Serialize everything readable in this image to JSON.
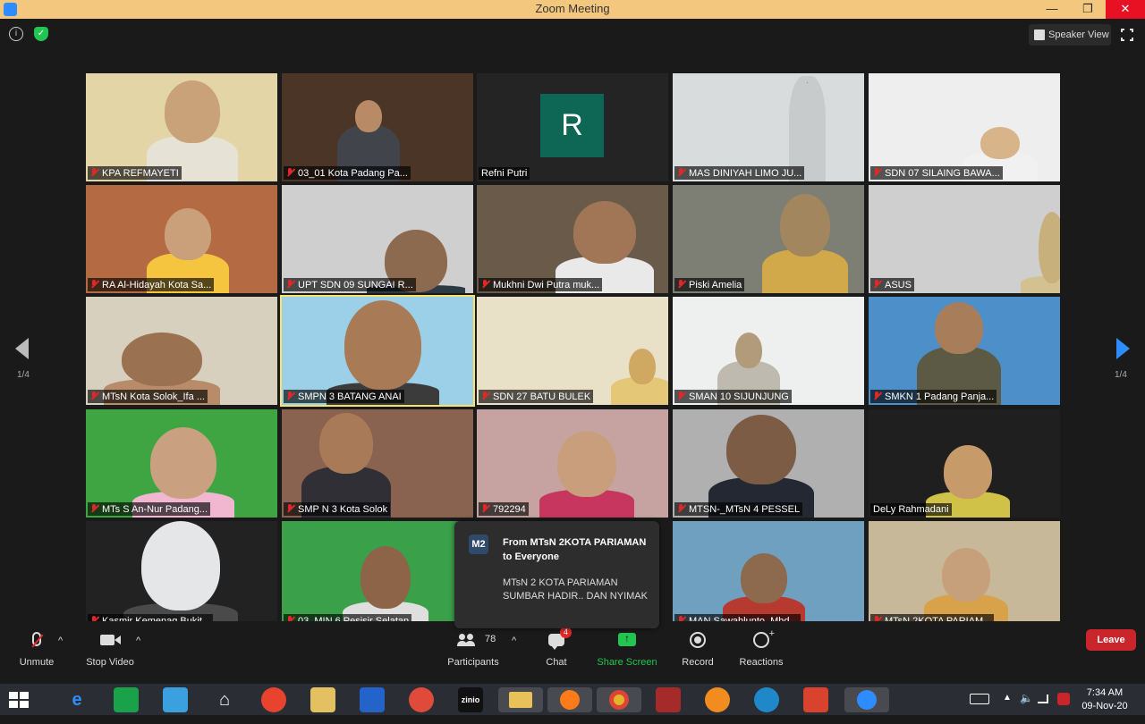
{
  "window": {
    "title": "Zoom Meeting",
    "minimize": "—",
    "restore": "❐",
    "close": "✕"
  },
  "top": {
    "view_label": "Speaker View"
  },
  "pager": {
    "left": "1/4",
    "right": "1/4"
  },
  "participants": [
    {
      "name": "KPA REFMAYETI",
      "muted": true
    },
    {
      "name": "03_01 Kota Padang Pa...",
      "muted": true
    },
    {
      "name": "Refni Putri",
      "muted": false,
      "avatar": "R"
    },
    {
      "name": "MAS DINIYAH LIMO JU...",
      "muted": true
    },
    {
      "name": "SDN 07 SILAING BAWA...",
      "muted": true
    },
    {
      "name": "RA Al-Hidayah Kota Sa...",
      "muted": true
    },
    {
      "name": "UPT SDN 09 SUNGAI R...",
      "muted": true
    },
    {
      "name": "Mukhni Dwi Putra muk...",
      "muted": true
    },
    {
      "name": "Piski Amelia",
      "muted": true
    },
    {
      "name": "ASUS",
      "muted": true
    },
    {
      "name": "MTsN Kota Solok_Ifa ...",
      "muted": true
    },
    {
      "name": "SMPN 3 BATANG ANAI",
      "muted": true,
      "active": true
    },
    {
      "name": "SDN 27 BATU BULEK",
      "muted": true
    },
    {
      "name": "SMAN 10 SIJUNJUNG",
      "muted": true
    },
    {
      "name": "SMKN 1 Padang Panja...",
      "muted": true
    },
    {
      "name": "MTs S An-Nur Padang...",
      "muted": true
    },
    {
      "name": "SMP N 3 Kota Solok",
      "muted": true
    },
    {
      "name": "792294",
      "muted": true
    },
    {
      "name": "MTSN-_MTsN 4 PESSEL",
      "muted": true
    },
    {
      "name": "DeLy Rahmadani",
      "muted": false
    },
    {
      "name": "Kasmir Kemenag Bukit...",
      "muted": true
    },
    {
      "name": "03_MIN 6 Pesisir Selatan",
      "muted": true
    },
    {
      "name": "",
      "muted": false
    },
    {
      "name": "MAN Sawahlunto_Mhd...",
      "muted": true
    },
    {
      "name": "MTsN 2KOTA PARIAM...",
      "muted": true
    }
  ],
  "chat_popup": {
    "badge": "M2",
    "from": "From MTsN 2KOTA PARIAMAN to Everyone",
    "message": "MTsN 2 KOTA PARIAMAN SUMBAR  HADIR.. DAN NYIMAK"
  },
  "toolbar": {
    "unmute": "Unmute",
    "stop_video": "Stop Video",
    "participants": "Participants",
    "participant_count": "78",
    "chat": "Chat",
    "chat_badge": "4",
    "share_screen": "Share Screen",
    "record": "Record",
    "reactions": "Reactions",
    "leave": "Leave"
  },
  "taskbar": {
    "time": "7:34 AM",
    "date": "09-Nov-20",
    "zinio": "zinio"
  },
  "colors": {
    "titlebar": "#f4c77e",
    "active_speaker": "#f7e26b",
    "share_green": "#23c552",
    "leave_red": "#c9252a",
    "accent_blue": "#2d8cff"
  }
}
